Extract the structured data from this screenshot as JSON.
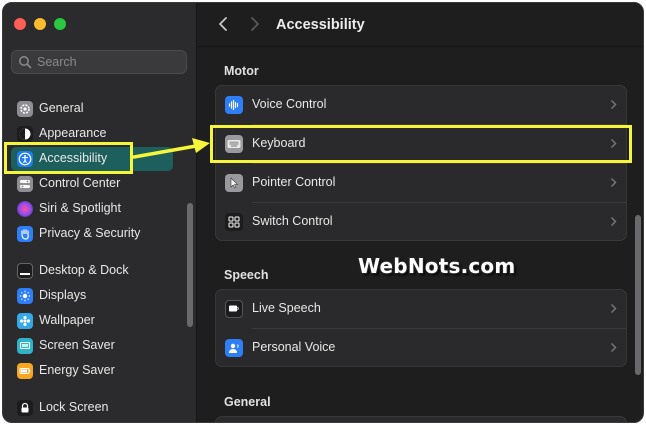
{
  "window": {
    "traffic_lights": {
      "close": "#ff5f57",
      "minimize": "#febc2e",
      "zoom": "#28c840"
    }
  },
  "search": {
    "placeholder": "Search"
  },
  "sidebar": {
    "items": [
      {
        "label": "General",
        "icon": "gear-icon",
        "color": "#8e8e93"
      },
      {
        "label": "Appearance",
        "icon": "appearance-icon",
        "color": "#1c1c1e"
      },
      {
        "label": "Accessibility",
        "icon": "accessibility-icon",
        "color": "#1e7cf2",
        "selected": true
      },
      {
        "label": "Control Center",
        "icon": "control-center-icon",
        "color": "#8e8e93"
      },
      {
        "label": "Siri & Spotlight",
        "icon": "siri-icon",
        "color": "#b04be0"
      },
      {
        "label": "Privacy & Security",
        "icon": "hand-icon",
        "color": "#2d7ef7"
      },
      {
        "label": "Desktop & Dock",
        "icon": "dock-icon",
        "color": "#1c1c1e"
      },
      {
        "label": "Displays",
        "icon": "displays-icon",
        "color": "#2d7ef7"
      },
      {
        "label": "Wallpaper",
        "icon": "wallpaper-icon",
        "color": "#35a9e8"
      },
      {
        "label": "Screen Saver",
        "icon": "screen-saver-icon",
        "color": "#32b2c9"
      },
      {
        "label": "Energy Saver",
        "icon": "battery-icon",
        "color": "#f5a623"
      },
      {
        "label": "Lock Screen",
        "icon": "lock-icon",
        "color": "#1c1c1e"
      }
    ]
  },
  "header": {
    "title": "Accessibility"
  },
  "main": {
    "sections": [
      {
        "title": "Motor",
        "rows": [
          {
            "label": "Voice Control",
            "icon": "voice-control-icon",
            "color": "#2d7ef7"
          },
          {
            "label": "Keyboard",
            "icon": "keyboard-icon",
            "color": "#9a9a9e"
          },
          {
            "label": "Pointer Control",
            "icon": "pointer-icon",
            "color": "#9a9a9e"
          },
          {
            "label": "Switch Control",
            "icon": "switch-control-icon",
            "color": "#1c1c1e"
          }
        ]
      },
      {
        "title": "Speech",
        "rows": [
          {
            "label": "Live Speech",
            "icon": "live-speech-icon",
            "color": "#1c1c1e"
          },
          {
            "label": "Personal Voice",
            "icon": "personal-voice-icon",
            "color": "#2d7ef7"
          }
        ]
      },
      {
        "title": "General",
        "rows": []
      }
    ]
  },
  "annotation": {
    "highlight_color": "#f5f53a"
  },
  "watermark": {
    "text": "WebNots.com"
  }
}
